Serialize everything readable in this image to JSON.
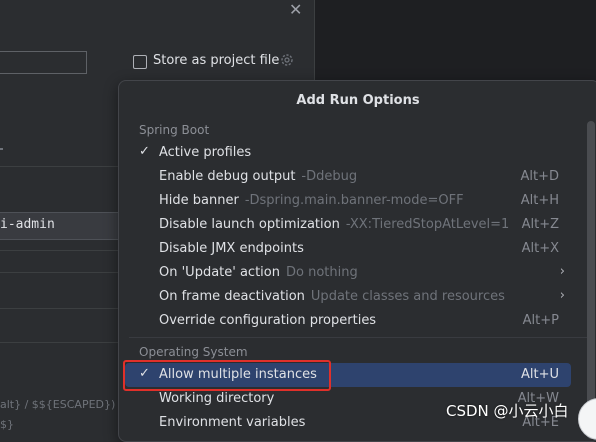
{
  "background_dialog": {
    "store_checkbox_label": "Store as project file",
    "module_value": "i-admin",
    "faded_line_1": "alt} / $${ESCAPED})",
    "faded_line_2": "$}"
  },
  "popup": {
    "title": "Add Run Options",
    "sections": [
      {
        "header": "Spring Boot",
        "items": [
          {
            "checked": true,
            "label": "Active profiles",
            "hint": "",
            "shortcut": "",
            "submenu": false
          },
          {
            "checked": false,
            "label": "Enable debug output",
            "hint": "-Ddebug",
            "shortcut": "Alt+D",
            "submenu": false
          },
          {
            "checked": false,
            "label": "Hide banner",
            "hint": "-Dspring.main.banner-mode=OFF",
            "shortcut": "Alt+H",
            "submenu": false
          },
          {
            "checked": false,
            "label": "Disable launch optimization",
            "hint": "-XX:TieredStopAtLevel=1",
            "shortcut": "Alt+Z",
            "submenu": false
          },
          {
            "checked": false,
            "label": "Disable JMX endpoints",
            "hint": "",
            "shortcut": "Alt+X",
            "submenu": false
          },
          {
            "checked": false,
            "label": "On 'Update' action",
            "hint": "Do nothing",
            "shortcut": "",
            "submenu": true
          },
          {
            "checked": false,
            "label": "On frame deactivation",
            "hint": "Update classes and resources",
            "shortcut": "",
            "submenu": true
          },
          {
            "checked": false,
            "label": "Override configuration properties",
            "hint": "",
            "shortcut": "Alt+P",
            "submenu": false
          }
        ]
      },
      {
        "header": "Operating System",
        "items": [
          {
            "checked": true,
            "label": "Allow multiple instances",
            "hint": "",
            "shortcut": "Alt+U",
            "submenu": false,
            "selected": true
          },
          {
            "checked": false,
            "label": "Working directory",
            "hint": "",
            "shortcut": "Alt+W",
            "submenu": false
          },
          {
            "checked": false,
            "label": "Environment variables",
            "hint": "",
            "shortcut": "Alt+E",
            "submenu": false
          }
        ]
      }
    ]
  },
  "watermark": "CSDN @小云小白",
  "colors": {
    "background": "#2b2d30",
    "selection": "#2e436e",
    "highlight_box": "#e0302a"
  }
}
